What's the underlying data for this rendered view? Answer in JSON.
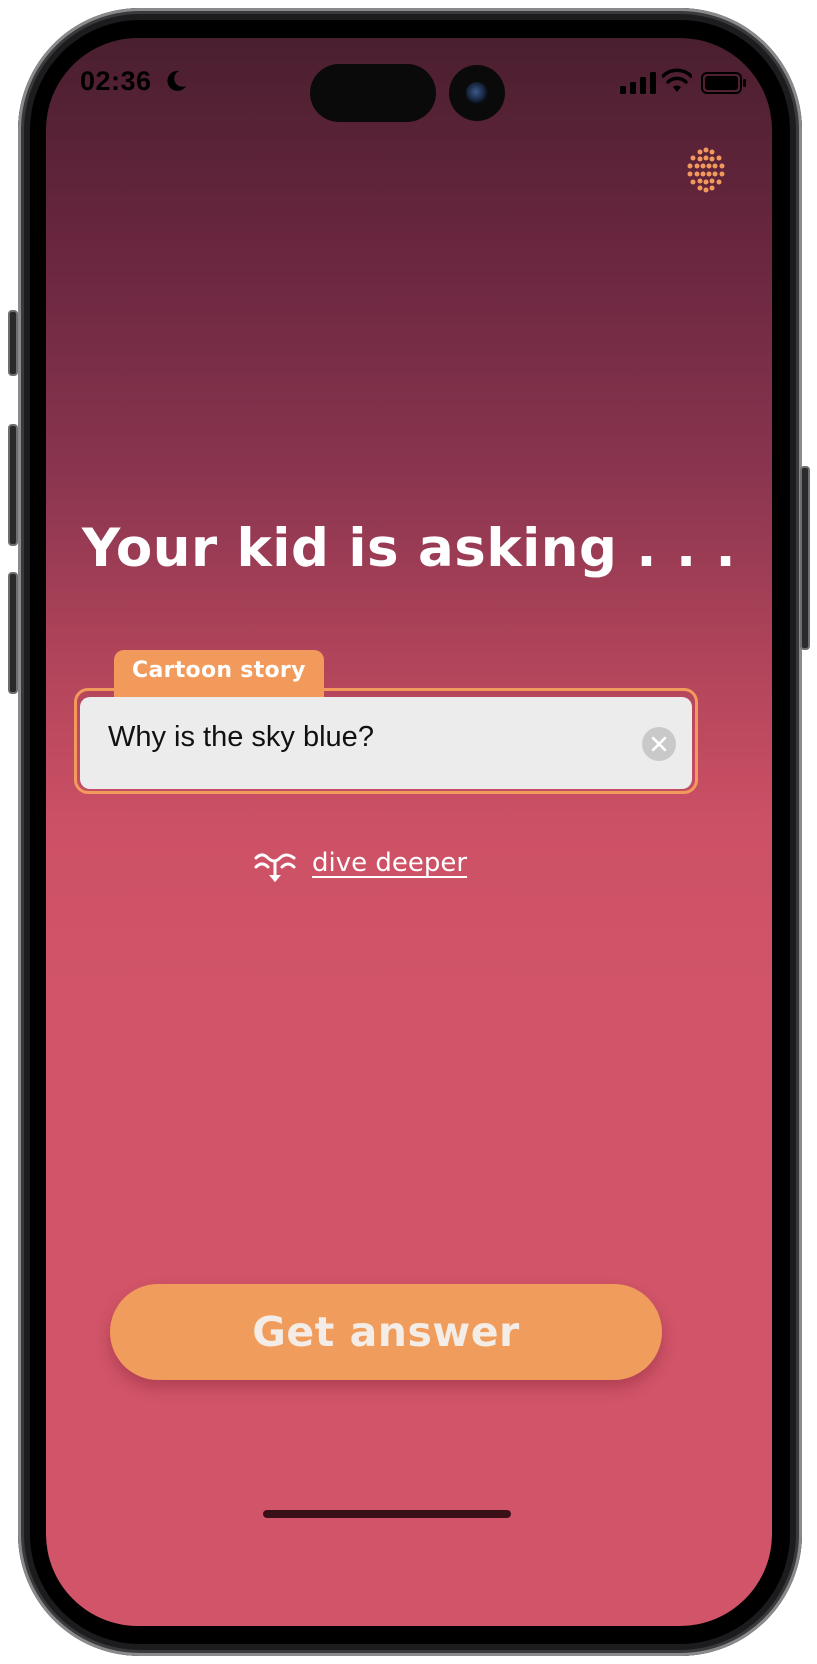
{
  "status_bar": {
    "time": "02:36",
    "icons": [
      "moon-icon",
      "signal-icon",
      "wifi-icon",
      "battery-icon"
    ]
  },
  "header": {
    "menu_icon": "dot-grid-icon"
  },
  "main": {
    "heading": "Your kid is asking . . .",
    "mode_tab": "Cartoon story",
    "question_input": {
      "value": "Why is the sky blue?",
      "clear_icon": "clear-icon"
    },
    "dive_deeper": {
      "icon": "dive-deeper-icon",
      "label": "dive deeper"
    }
  },
  "footer": {
    "cta_label": "Get answer"
  },
  "colors": {
    "gradient_top": "#4a1f2f",
    "gradient_bottom": "#d15468",
    "accent": "#f29a5c",
    "input_bg": "#ececec"
  }
}
